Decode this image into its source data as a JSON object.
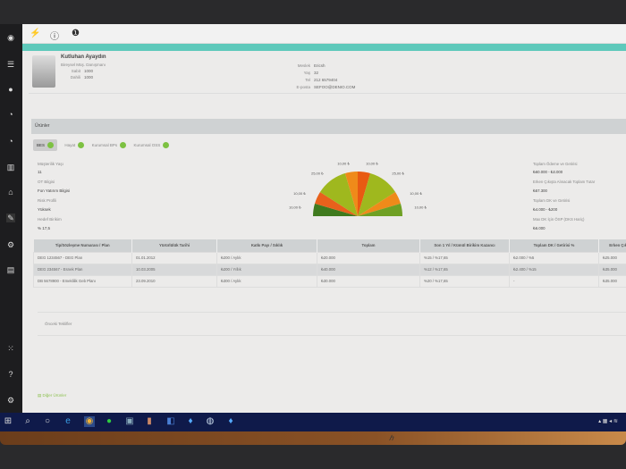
{
  "toolbar": {
    "icons": [
      "pin-icon",
      "info-icon",
      "alert-icon"
    ]
  },
  "profile": {
    "name": "Kutluhan Ayaydın",
    "title": "Bireysel Müş. Danışmanı",
    "fields_left": [
      {
        "label": "Sabit",
        "value": "1000"
      },
      {
        "label": "Dahili",
        "value": "1000"
      }
    ],
    "fields_right": [
      {
        "label": "Meslek",
        "value": "Ericsh"
      },
      {
        "label": "Yaş",
        "value": "32"
      },
      {
        "label": "Tel",
        "value": "212 6579404"
      },
      {
        "label": "E-posta",
        "value": "SEFOO@DENIO.COM"
      }
    ]
  },
  "section_title": "Ürünler",
  "tabs": [
    {
      "label": "BES",
      "active": true
    },
    {
      "label": "Hayat"
    },
    {
      "label": "Kurumsal BPs"
    },
    {
      "label": "Kurumsal OSS"
    }
  ],
  "info": [
    {
      "label": "Müşterilik Yaşı",
      "value": "11"
    },
    {
      "label": "OT Bilgisi",
      "value": "Fon Yatırım Bilgisi"
    },
    {
      "label": "Risk Profili",
      "value": "Yüksek"
    },
    {
      "label": "Hedef Birikim",
      "value": "% 17,5"
    }
  ],
  "right_info": [
    {
      "label": "Toplam Ödeme ve Getirisi",
      "value": "₺60.000 - ₺3.000"
    },
    {
      "label": "Erken Çıkışta Alınacak Toplam Tutar",
      "value": "₺57.300"
    },
    {
      "label": "Toplam DK ve Getirisi",
      "value": "₺4.000 - ₺200"
    },
    {
      "label": "Max DK İçin ÖSP (DKS Hariç)",
      "value": "₺6.000"
    }
  ],
  "chart_data": {
    "type": "pie",
    "subtype": "semi-donut gauge",
    "labels": [
      "10,00 ₺",
      "10,00 ₺",
      "25,00 ₺",
      "10,00 ₺",
      "10,00 ₺",
      "25,00 ₺",
      "10,00 ₺",
      "10,00 ₺"
    ],
    "values": [
      10,
      10,
      25,
      10,
      10,
      25,
      10,
      10
    ],
    "colors": [
      "#3f7a1e",
      "#e8611c",
      "#9fb81e",
      "#ef8a1a",
      "#e85a12",
      "#9fb81e",
      "#ef8a1a",
      "#6fa024"
    ]
  },
  "table": {
    "headers": [
      "Tip/Sözleşme Numarası / Plan",
      "Yürürlülük Tarihi",
      "Katkı Payı / Sıklık",
      "Toplam",
      "Son 1 Yıl / Kümül Birikim Kazancı",
      "Toplam DK / Getirisi %",
      "Erken Çıkış"
    ],
    "rows": [
      [
        "DEG 1234567 - DEG Plan",
        "01.01.2012",
        "₺200 / Aylık",
        "₺20.000",
        "%15 / %17,65",
        "₺2.000 / %5",
        "₺25.000"
      ],
      [
        "DEG 234567 - Esnek Plan",
        "10.03.2005",
        "₺200 / Yıllık",
        "₺40.000",
        "%12 / %17,65",
        "₺2.400 / %15",
        "₺35.000"
      ],
      [
        "DB 5678900 - Emeklilik Geb Planı",
        "23.09.2010",
        "₺300 / Aylık",
        "₺30.000",
        "%20 / %17,65",
        "-",
        "₺35.000"
      ]
    ]
  },
  "previous_offers": "Önceki Teklifler",
  "other_products": "Diğer Ürünler",
  "brand": "hp"
}
